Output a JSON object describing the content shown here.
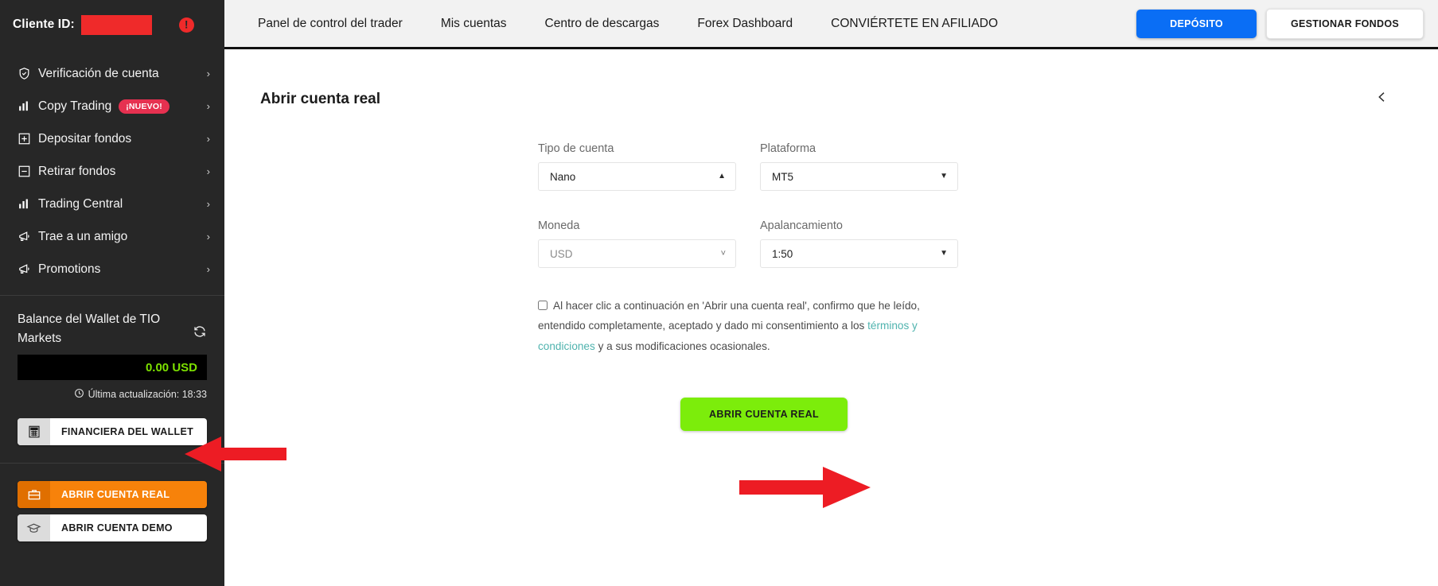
{
  "header": {
    "client_id_label": "Cliente ID:",
    "client_id_value": "",
    "warning_icon": "alert-icon",
    "nav": [
      {
        "label": "Panel de control del trader"
      },
      {
        "label": "Mis cuentas"
      },
      {
        "label": "Centro de descargas"
      },
      {
        "label": "Forex Dashboard"
      },
      {
        "label": "CONVIÉRTETE EN AFILIADO"
      }
    ],
    "deposit_button": "DEPÓSITO",
    "manage_funds_button": "GESTIONAR FONDOS",
    "accent_blue": "#0a6ef5"
  },
  "sidebar": {
    "items": [
      {
        "label": "Verificación de cuenta",
        "icon": "shield-check-icon",
        "badge": ""
      },
      {
        "label": "Copy Trading",
        "icon": "bar-chart-icon",
        "badge": "¡NUEVO!"
      },
      {
        "label": "Depositar fondos",
        "icon": "plus-box-icon",
        "badge": ""
      },
      {
        "label": "Retirar fondos",
        "icon": "minus-box-icon",
        "badge": ""
      },
      {
        "label": "Trading Central",
        "icon": "bar-chart-icon",
        "badge": ""
      },
      {
        "label": "Trae a un amigo",
        "icon": "megaphone-icon",
        "badge": ""
      },
      {
        "label": "Promotions",
        "icon": "megaphone-icon",
        "badge": ""
      }
    ],
    "wallet": {
      "title": "Balance del Wallet de TIO Markets",
      "refresh_icon": "refresh-icon",
      "balance": "0.00 USD",
      "balance_color": "#7ce000",
      "updated_icon": "clock-icon",
      "updated_label": "Última actualización: 18:33"
    },
    "buttons": {
      "wallet_finance": {
        "label": "FINANCIERA DEL WALLET",
        "icon": "calculator-icon"
      },
      "open_real": {
        "label": "ABRIR CUENTA REAL",
        "icon": "briefcase-icon",
        "color": "#f7820a"
      },
      "open_demo": {
        "label": "ABRIR CUENTA DEMO",
        "icon": "graduation-cap-icon"
      }
    },
    "badge_color": "#e63150"
  },
  "main": {
    "title": "Abrir cuenta real",
    "collapse_icon": "chevron-left-icon",
    "form": {
      "account_type": {
        "label": "Tipo de cuenta",
        "value": "Nano",
        "caret": "caret-up-icon"
      },
      "platform": {
        "label": "Plataforma",
        "value": "MT5",
        "caret": "caret-down-icon"
      },
      "currency": {
        "label": "Moneda",
        "value": "USD",
        "caret": "chevron-down-icon"
      },
      "leverage": {
        "label": "Apalancamiento",
        "value": "1:50",
        "caret": "caret-down-icon"
      }
    },
    "consent": {
      "checked": false,
      "text_part1": "Al hacer clic a continuación en 'Abrir una cuenta real', confirmo que he leído, entendido completamente, aceptado y dado mi consentimiento a los ",
      "link_text": "términos y condiciones",
      "text_part2": " y a sus modificaciones ocasionales.",
      "link_color": "#4fb3ae"
    },
    "submit_button": {
      "label": "ABRIR CUENTA REAL",
      "color": "#7ced0b"
    }
  },
  "annotations": {
    "arrow_color": "#ed1c24",
    "sidebar_arrow": "red-arrow-pointing-left",
    "cta_arrow": "red-arrow-pointing-right"
  }
}
